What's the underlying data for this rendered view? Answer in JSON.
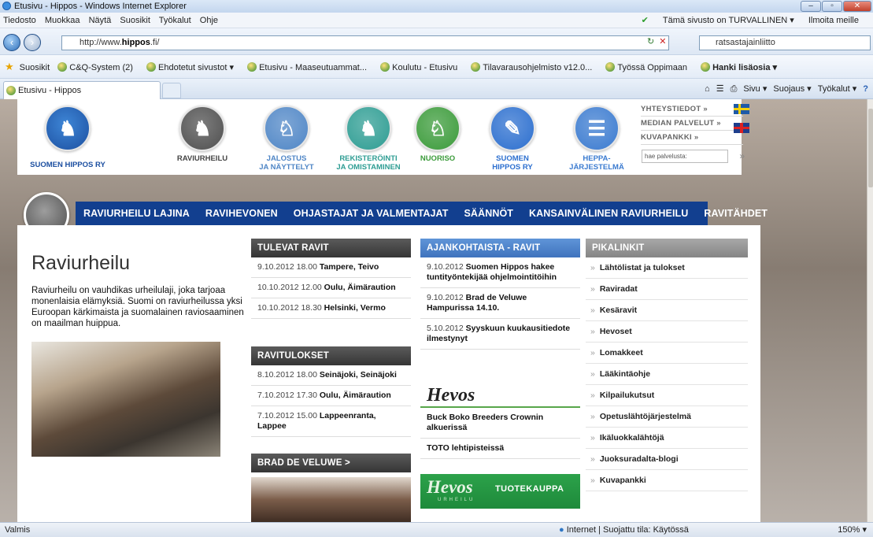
{
  "window": {
    "title": "Etusivu - Hippos - Windows Internet Explorer",
    "buttons": [
      "–",
      "▫",
      "✕"
    ]
  },
  "menubar": {
    "items": [
      "Tiedosto",
      "Muokkaa",
      "Näytä",
      "Suosikit",
      "Työkalut",
      "Ohje"
    ],
    "security_notice": "Tämä sivusto on TURVALLINEN ▾",
    "report": "Ilmoita meille"
  },
  "addressbar": {
    "url_prefix": "http://www.",
    "url_domain": "hippos",
    "url_suffix": ".fi/",
    "search_value": "ratsastajainliitto"
  },
  "favorites": {
    "label": "Suosikit",
    "items": [
      "C&Q-System (2)",
      "Ehdotetut sivustot ▾",
      "Etusivu - Maaseutuammat...",
      "Koulutu - Etusivu",
      "Tilavarausohjelmisto v12.0...",
      "Työssä Oppimaan",
      "Hanki lisäosia ▾"
    ]
  },
  "tabs": {
    "active_title": "Etusivu - Hippos",
    "commands": [
      "Sivu ▾",
      "Suojaus ▾",
      "Työkalut ▾"
    ]
  },
  "site": {
    "brand_label": "SUOMEN HIPPOS RY",
    "nav_logos": [
      {
        "label": "RAVIURHEILU",
        "color": "#4f4f4f"
      },
      {
        "label": "JALOSTUS\nJA NÄYTTELYT",
        "color": "#4f86c6"
      },
      {
        "label": "REKISTERÖINTI\nJA OMISTAMINEN",
        "color": "#2e9d93"
      },
      {
        "label": "NUORISO",
        "color": "#3b9b3a"
      },
      {
        "label": "SUOMEN\nHIPPOS RY",
        "color": "#2c6fcf"
      },
      {
        "label": "HEPPA-\nJÄRJESTELMÄ",
        "color": "#3b7bd0"
      }
    ],
    "top_links": [
      "YHTEYSTIEDOT »",
      "MEDIAN PALVELUT »",
      "KUVAPANKKI »"
    ],
    "search_placeholder": "hae palvelusta:",
    "subnav": [
      "RAVIURHEILU LAJINA",
      "RAVIHEVONEN",
      "OHJASTAJAT JA VALMENTAJAT",
      "SÄÄNNÖT",
      "KANSAINVÄLINEN RAVIURHEILU",
      "RAVITÄHDET"
    ],
    "intro": {
      "title": "Raviurheilu",
      "text": "Raviurheilu on vauhdikas urheilulaji, joka tarjoaa monenlaisia elämyksiä. Suomi on raviurheilussa yksi Euroopan kärkimaista ja suomalainen raviosaaminen on maailman huippua."
    },
    "upcoming": {
      "title": "TULEVAT RAVIT",
      "rows": [
        {
          "date": "9.10.2012 18.00",
          "place": "Tampere, Teivo"
        },
        {
          "date": "10.10.2012 12.00",
          "place": "Oulu, Äimäraution"
        },
        {
          "date": "10.10.2012 18.30",
          "place": "Helsinki, Vermo"
        }
      ]
    },
    "results": {
      "title": "RAVITULOKSET",
      "rows": [
        {
          "date": "8.10.2012 18.00",
          "place": "Seinäjoki, Seinäjoki"
        },
        {
          "date": "7.10.2012 17.30",
          "place": "Oulu, Äimäraution"
        },
        {
          "date": "7.10.2012 15.00",
          "place": "Lappeenranta, Lappee"
        }
      ]
    },
    "brad": {
      "title": "BRAD DE VELUWE >"
    },
    "news": {
      "title": "AJANKOHTAISTA - RAVIT",
      "rows": [
        {
          "date": "9.10.2012",
          "text": "Suomen Hippos hakee tuntityöntekijää ohjelmointitöihin"
        },
        {
          "date": "9.10.2012",
          "text": "Brad de Veluwe Hampurissa 14.10."
        },
        {
          "date": "5.10.2012",
          "text": "Syyskuun kuukausitiedote ilmestynyt"
        }
      ]
    },
    "hevos": {
      "logo": "Hevos",
      "rows": [
        "Buck Boko Breeders Crownin alkuerissä",
        "TOTO lehtipisteissä"
      ]
    },
    "shop": {
      "logo": "Hevos",
      "sub": "URHEILU",
      "label": "TUOTEKAUPPA"
    },
    "quicklinks": {
      "title": "PIKALINKIT",
      "items": [
        "Lähtölistat ja tulokset",
        "Raviradat",
        "Kesäravit",
        "Hevoset",
        "Lomakkeet",
        "Lääkintäohje",
        "Kilpailukutsut",
        "Opetuslähtöjärjestelmä",
        "Ikäluokkalähtöjä",
        "Juoksuradalta-blogi",
        "Kuvapankki"
      ]
    }
  },
  "status": {
    "left": "Valmis",
    "zone": "Internet | Suojattu tila: Käytössä",
    "zoom": "150% ▾"
  }
}
